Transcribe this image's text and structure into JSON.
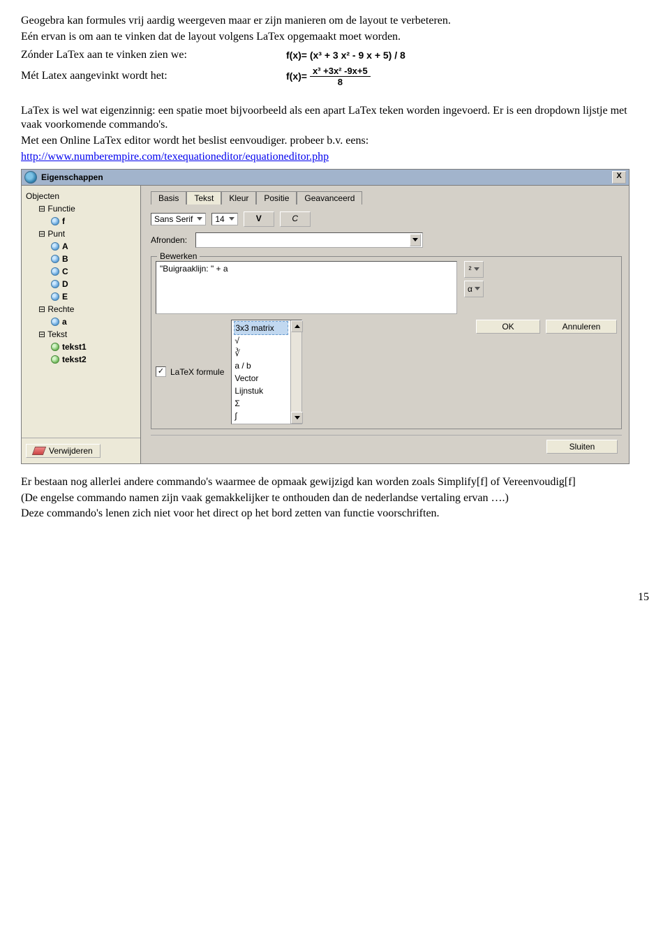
{
  "intro": {
    "p1": "Geogebra kan formules vrij aardig weergeven maar er zijn manieren om de layout te verbeteren.",
    "p2": "Eén ervan is om aan te vinken dat de layout volgens LaTex opgemaakt moet worden.",
    "without_label": "Zónder LaTex aan te vinken zien we:",
    "without_formula": "f(x)= (x³ + 3 x² - 9 x + 5) / 8",
    "with_label": "Mét Latex aangevinkt wordt het:",
    "with_formula_lhs": "f(x)=",
    "with_formula_num": "x³ +3x² -9x+5",
    "with_formula_den": "8",
    "p3": "LaTex is wel wat eigenzinnig: een spatie moet bijvoorbeeld als een apart LaTex teken worden ingevoerd. Er is een dropdown lijstje met vaak voorkomende commando's.",
    "p4": "Met een Online LaTex editor wordt het beslist eenvoudiger. probeer b.v. eens:",
    "link": "http://www.numberempire.com/texequationeditor/equationeditor.php"
  },
  "dialog": {
    "title": "Eigenschappen",
    "close": "X",
    "tree": {
      "h1": "Objecten",
      "g_functie": "Functie",
      "n_f": "f",
      "g_punt": "Punt",
      "n_A": "A",
      "n_B": "B",
      "n_C": "C",
      "n_D": "D",
      "n_E": "E",
      "g_rechte": "Rechte",
      "n_a": "a",
      "g_tekst": "Tekst",
      "n_t1": "tekst1",
      "n_t2": "tekst2"
    },
    "delete_btn": "Verwijderen",
    "tabs": {
      "basis": "Basis",
      "tekst": "Tekst",
      "kleur": "Kleur",
      "positie": "Positie",
      "geavanceerd": "Geavanceerd"
    },
    "font_family": "Sans Serif",
    "font_size": "14",
    "bold": "V",
    "italic": "C",
    "afronden_label": "Afronden:",
    "bewerken_legend": "Bewerken",
    "textarea_value": "\"Buigraaklijn: \" + a",
    "side1": "²",
    "side2": "α",
    "latex_checkbox": "LaTeX formule",
    "latex_checked": "✓",
    "listbox": {
      "sel": "3x3 matrix",
      "i1": "√",
      "i2": "∛",
      "i3": "a / b",
      "i4": "Vector",
      "i5": "Lijnstuk",
      "i6": "Σ",
      "i7": "∫"
    },
    "ok": "OK",
    "annuleren": "Annuleren",
    "sluiten": "Sluiten"
  },
  "outro": {
    "p1": "Er bestaan nog allerlei andere commando's waarmee de opmaak gewijzigd kan worden zoals Simplify[f] of Vereenvoudig[f]",
    "p2": "(De engelse commando namen zijn vaak gemakkelijker te onthouden dan de nederlandse vertaling ervan ….)",
    "p3": "Deze commando's lenen zich niet voor het direct op het bord zetten van functie voorschriften."
  },
  "page_number": "15"
}
